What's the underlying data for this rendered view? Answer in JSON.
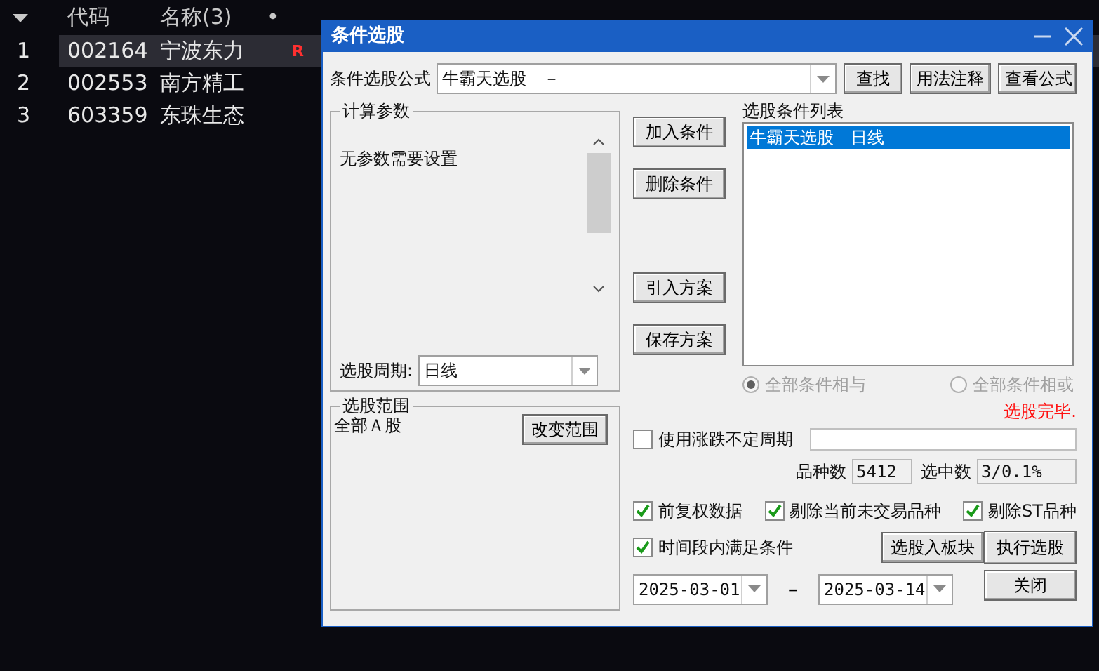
{
  "table": {
    "columns": [
      {
        "label": "代码",
        "kind": "text"
      },
      {
        "label": "名称(3)",
        "kind": "text"
      },
      {
        "label": "•",
        "kind": "dot"
      }
    ],
    "rows": [
      {
        "index": "1",
        "code": "002164",
        "name": "宁波东力",
        "flag": "R",
        "selected": true
      },
      {
        "index": "2",
        "code": "002553",
        "name": "南方精工",
        "selected": false
      },
      {
        "index": "3",
        "code": "603359",
        "name": "东珠生态",
        "selected": false
      }
    ]
  },
  "dialog": {
    "title": "条件选股",
    "formula": {
      "label": "条件选股公式",
      "value": "牛霸天选股　－"
    },
    "top_buttons": [
      "查找",
      "用法注释",
      "查看公式"
    ],
    "params": {
      "title": "计算参数",
      "message": "无参数需要设置",
      "period_label": "选股周期:",
      "period_value": "日线"
    },
    "middle_buttons": [
      {
        "label": "加入条件"
      },
      {
        "label": "删除条件"
      },
      {
        "label": "引入方案"
      },
      {
        "label": "保存方案"
      }
    ],
    "condition_list": {
      "label": "选股条件列表",
      "items": [
        {
          "text": "牛霸天选股　日线",
          "selected": true
        }
      ]
    },
    "logic_options": [
      {
        "label": "全部条件相与",
        "selected": true,
        "disabled": true
      },
      {
        "label": "全部条件相或",
        "selected": false,
        "disabled": true
      }
    ],
    "status": "选股完毕.",
    "range": {
      "title": "选股范围",
      "value": "全部Ａ股",
      "button": "改变范围"
    },
    "variable_period": {
      "label": "使用涨跌不定周期",
      "checked": false
    },
    "counts": [
      {
        "label": "品种数",
        "value": "5412"
      },
      {
        "label": "选中数",
        "value": "3/0.1%"
      }
    ],
    "options": [
      {
        "label": "前复权数据",
        "checked": true
      },
      {
        "label": "剔除当前未交易品种",
        "checked": true
      },
      {
        "label": "剔除ST品种",
        "checked": true
      }
    ],
    "time_filter": {
      "label": "时间段内满足条件",
      "checked": true
    },
    "board_button": "选股入板块",
    "run_button": "执行选股",
    "start_date": "2025-03-01",
    "date_separator": "－",
    "end_date": "2025-03-14",
    "close_button": "关闭"
  }
}
